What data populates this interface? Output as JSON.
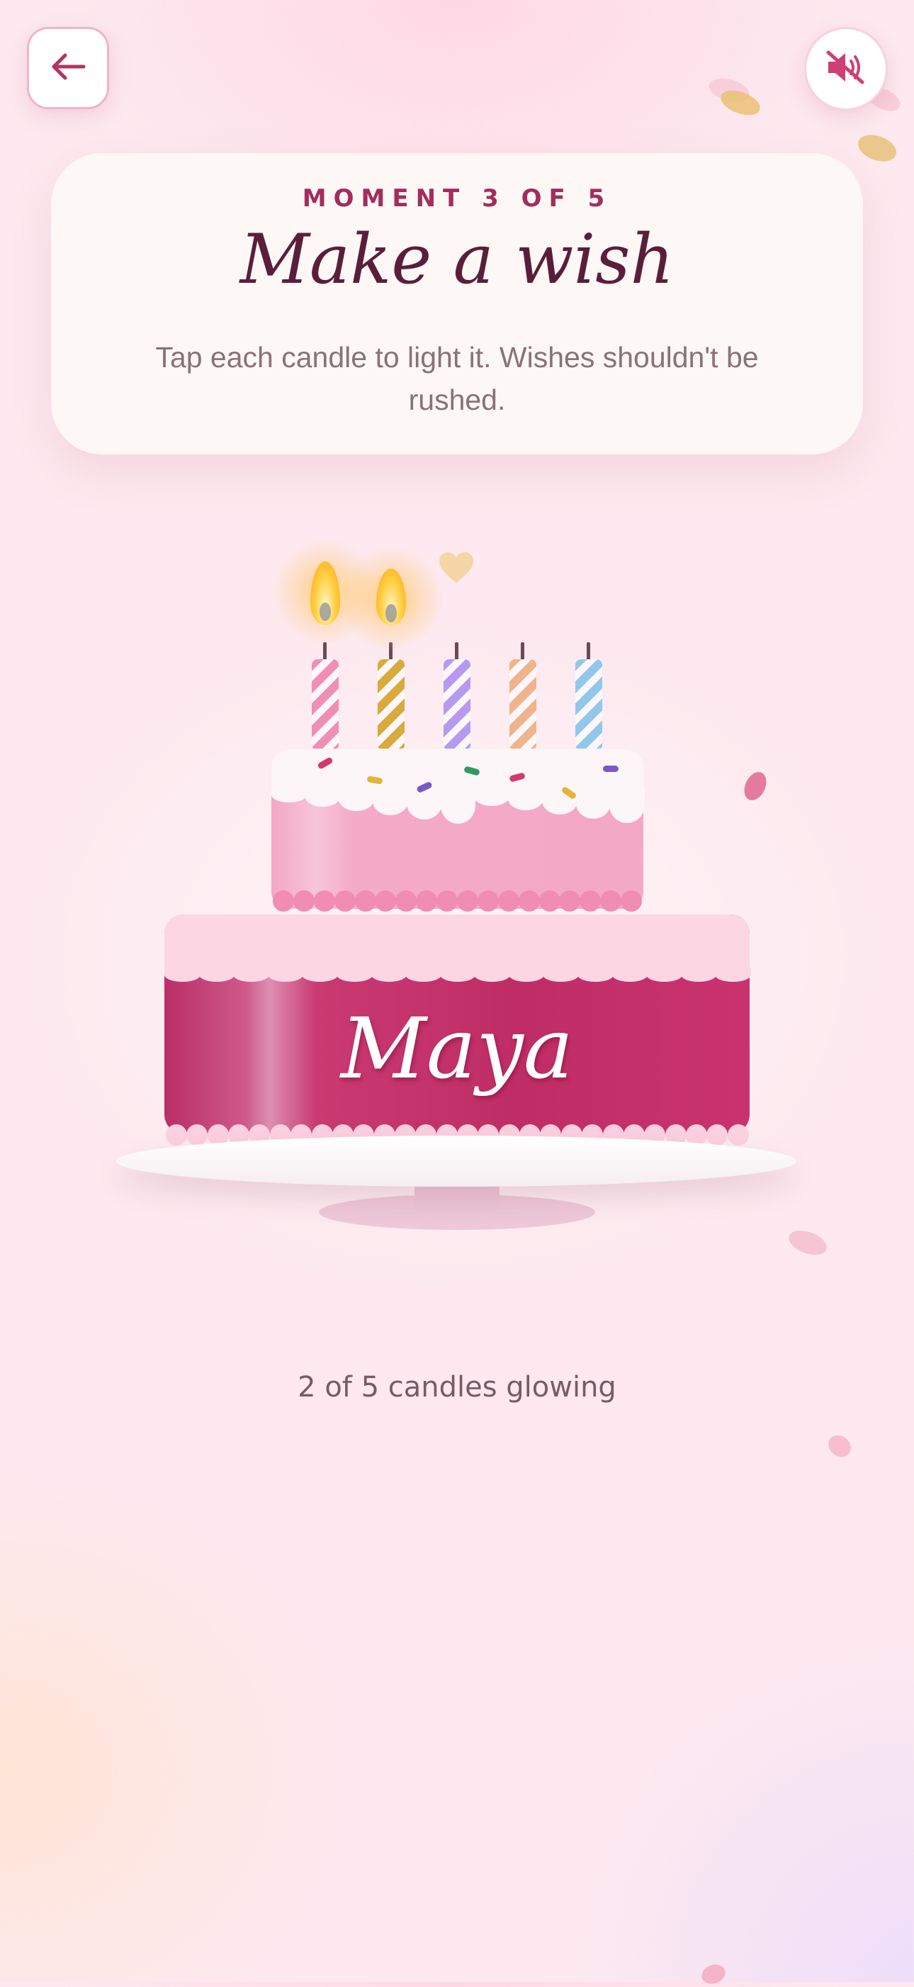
{
  "header": {
    "back_icon": "arrow-left-icon",
    "sound_icon": "speaker-muted-icon"
  },
  "card": {
    "eyebrow": "MOMENT 3 OF 5",
    "title": "Make a wish",
    "subtitle": "Tap each candle to light it. Wishes shouldn't be rushed."
  },
  "cake": {
    "name": "Maya",
    "candles": [
      {
        "label": "candle-1",
        "color": "#f08fb5",
        "lit": true
      },
      {
        "label": "candle-2",
        "color": "#d9aa3c",
        "lit": true
      },
      {
        "label": "candle-3",
        "color": "#b69af0",
        "lit": false
      },
      {
        "label": "candle-4",
        "color": "#f0b48c",
        "lit": false
      },
      {
        "label": "candle-5",
        "color": "#92c7ec",
        "lit": false
      }
    ]
  },
  "status": {
    "text": "2 of 5 candles glowing",
    "lit_count": 2,
    "total": 5
  },
  "colors": {
    "accent": "#a32d5c",
    "title": "#5b1e3a",
    "cake_bottom": "#c02d66",
    "cake_top": "#f3a8c5"
  }
}
